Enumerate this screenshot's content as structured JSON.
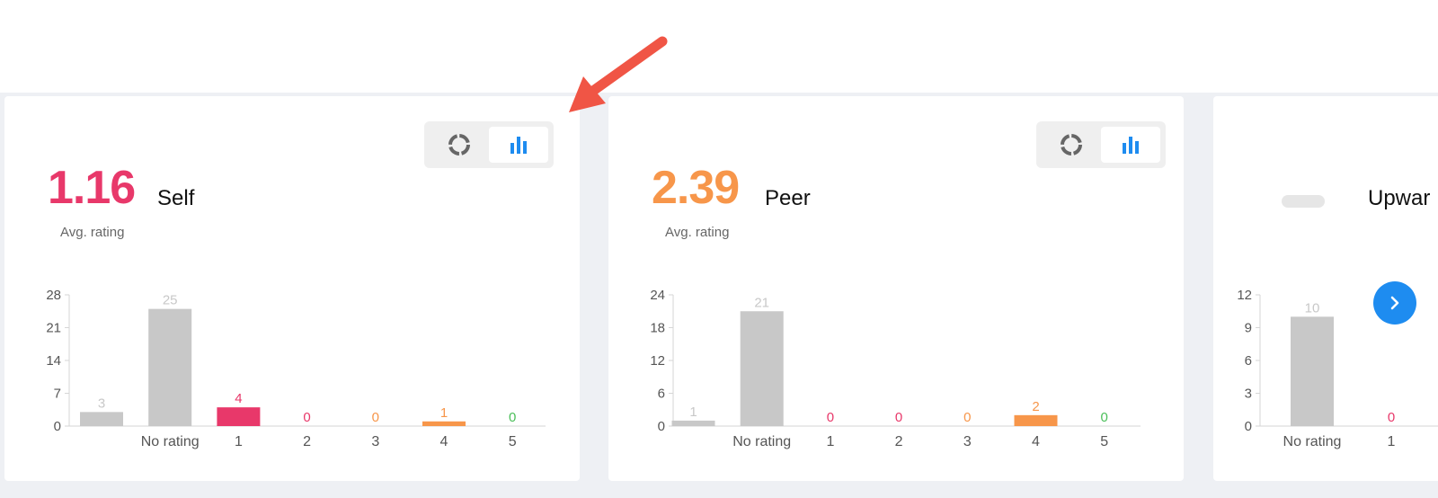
{
  "colors": {
    "self": "#e8386a",
    "peer": "#f7964a",
    "gray_bar": "#c8c8c8",
    "zero_green": "#4bbf5a",
    "accent_blue": "#1e8cf0",
    "arrow": "#f05545"
  },
  "toggle_icons": [
    "donut-chart-icon",
    "bar-chart-icon"
  ],
  "cards": [
    {
      "avg": "1.16",
      "avg_color": "#e8386a",
      "label": "Self",
      "sub": "Avg. rating",
      "chart_data": {
        "type": "bar",
        "categories": [
          "",
          "No rating",
          "1",
          "2",
          "3",
          "4",
          "5"
        ],
        "values": [
          3,
          25,
          4,
          0,
          0,
          1,
          0
        ],
        "value_label_colors": [
          "#c8c8c8",
          "#c8c8c8",
          "#e8386a",
          "#e8386a",
          "#f7964a",
          "#f7964a",
          "#4bbf5a"
        ],
        "bar_colors": [
          "#c8c8c8",
          "#c8c8c8",
          "#e8386a",
          "#e8386a",
          "#f7964a",
          "#f7964a",
          "#4bbf5a"
        ],
        "yticks": [
          0,
          7,
          14,
          21,
          28
        ],
        "ylim": [
          0,
          28
        ]
      }
    },
    {
      "avg": "2.39",
      "avg_color": "#f7964a",
      "label": "Peer",
      "sub": "Avg. rating",
      "chart_data": {
        "type": "bar",
        "categories": [
          "",
          "No rating",
          "1",
          "2",
          "3",
          "4",
          "5"
        ],
        "values": [
          1,
          21,
          0,
          0,
          0,
          2,
          0
        ],
        "value_label_colors": [
          "#c8c8c8",
          "#c8c8c8",
          "#e8386a",
          "#e8386a",
          "#f7964a",
          "#f7964a",
          "#4bbf5a"
        ],
        "bar_colors": [
          "#c8c8c8",
          "#c8c8c8",
          "#e8386a",
          "#e8386a",
          "#f7964a",
          "#f7964a",
          "#4bbf5a"
        ],
        "yticks": [
          0,
          6,
          12,
          18,
          24
        ],
        "ylim": [
          0,
          24
        ]
      }
    },
    {
      "label": "Upwar",
      "chart_data": {
        "type": "bar",
        "categories": [
          "No rating",
          "1"
        ],
        "values": [
          10,
          0
        ],
        "value_label_colors": [
          "#c8c8c8",
          "#e8386a"
        ],
        "bar_colors": [
          "#c8c8c8",
          "#e8386a"
        ],
        "yticks": [
          0,
          3,
          6,
          9,
          12
        ],
        "ylim": [
          0,
          12
        ]
      }
    }
  ]
}
